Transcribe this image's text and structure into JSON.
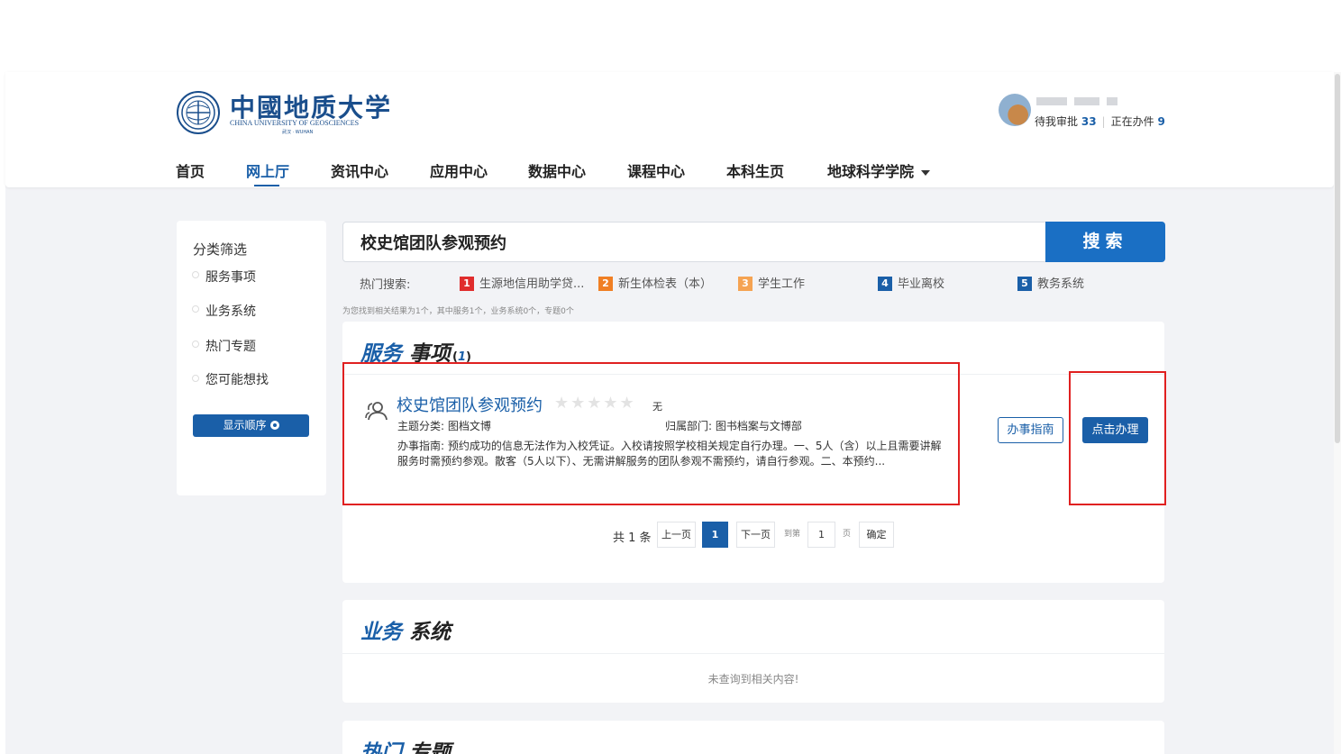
{
  "header": {
    "logo_title": "中國地质大学",
    "logo_subtitle": "CHINA UNIVERSITY OF GEOSCIENCES",
    "logo_city": "武汉 · WUHAN",
    "user": {
      "pending_label": "待我审批",
      "pending_count": "33",
      "doing_label": "正在办件",
      "doing_count": "9",
      "separator": "|"
    }
  },
  "nav": {
    "items": [
      {
        "label": "首页"
      },
      {
        "label": "网上厅"
      },
      {
        "label": "资讯中心"
      },
      {
        "label": "应用中心"
      },
      {
        "label": "数据中心"
      },
      {
        "label": "课程中心"
      },
      {
        "label": "本科生页"
      },
      {
        "label": "地球科学学院"
      }
    ],
    "active_index": 1
  },
  "sidebar": {
    "title": "分类筛选",
    "items": [
      {
        "label": "服务事项"
      },
      {
        "label": "业务系统"
      },
      {
        "label": "热门专题"
      },
      {
        "label": "您可能想找"
      }
    ],
    "sort_button": "显示顺序"
  },
  "search": {
    "value": "校史馆团队参观预约",
    "button": "搜索",
    "hot_label": "热门搜索:",
    "hot_items": [
      {
        "num": "1",
        "text": "生源地信用助学贷...",
        "color": "#e02d2d"
      },
      {
        "num": "2",
        "text": "新生体检表（本）",
        "color": "#f07f24"
      },
      {
        "num": "3",
        "text": "学生工作",
        "color": "#f5a352"
      },
      {
        "num": "4",
        "text": "毕业离校",
        "color": "#1a5fa8"
      },
      {
        "num": "5",
        "text": "教务系统",
        "color": "#1a5fa8"
      }
    ],
    "summary": "为您找到相关结果为1个，其中服务1个，业务系统0个，专题0个"
  },
  "services": {
    "title_accent": "服务",
    "title_rest": " 事项",
    "count_open": "(",
    "count": "1",
    "count_close": ")",
    "item": {
      "name": "校史馆团队参观预约",
      "stars": "★★★★★",
      "rating": 0,
      "rating_text": "无",
      "category_label": "主题分类:",
      "category": "图档文博",
      "dept_label": "归属部门:",
      "dept": "图书档案与文博部",
      "desc": "办事指南: 预约成功的信息无法作为入校凭证。入校请按照学校相关规定自行办理。一、5人（含）以上且需要讲解服务时需预约参观。散客（5人以下）、无需讲解服务的团队参观不需预约，请自行参观。二、本预约...",
      "guide_button": "办事指南",
      "handle_button": "点击办理"
    },
    "pager": {
      "total": "共 1 条",
      "prev": "上一页",
      "current": "1",
      "next": "下一页",
      "goto_label": "到第",
      "page_input": "1",
      "page_unit": "页",
      "confirm": "确定"
    }
  },
  "business": {
    "title_accent": "业务",
    "title_rest": " 系统",
    "empty": "未查询到相关内容!"
  },
  "topics": {
    "title_accent": "热门",
    "title_rest": " 专题"
  },
  "colors": {
    "primary": "#1a5fa8",
    "highlight": "#e02020",
    "background": "#f2f3f6"
  }
}
